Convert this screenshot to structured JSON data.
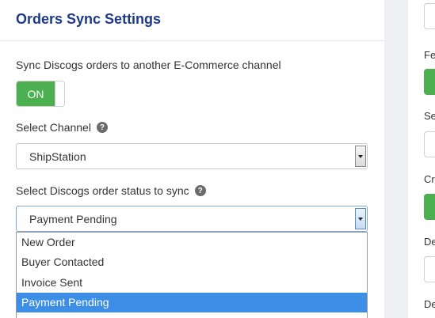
{
  "panel": {
    "title": "Orders Sync Settings",
    "sync_label": "Sync Discogs orders to another E-Commerce channel",
    "toggle_label": "ON",
    "channel_label": "Select Channel",
    "channel_value": "ShipStation",
    "status_label": "Select Discogs order status to sync",
    "status_value": "Payment Pending",
    "help_glyph": "?",
    "status_options": [
      "New Order",
      "Buyer Contacted",
      "Invoice Sent",
      "Payment Pending"
    ],
    "selected_option": "Payment Pending"
  },
  "right_panel": {
    "labels": [
      "Fe",
      "Se",
      "Cr",
      "De",
      "De"
    ]
  },
  "colors": {
    "title": "#1d3a8a",
    "toggle_on": "#4caf50",
    "option_highlight": "#3d8ee6"
  }
}
